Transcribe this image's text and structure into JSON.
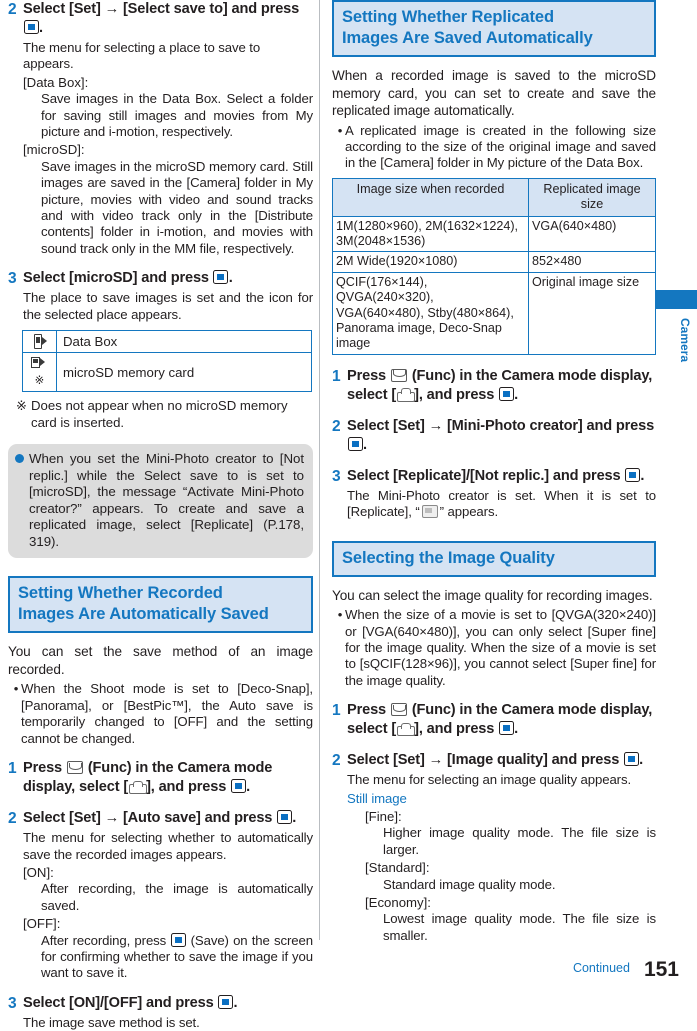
{
  "page": {
    "number": "151",
    "continued_label": "Continued",
    "side_tab_label": "Camera"
  },
  "left_column": {
    "step2": {
      "num": "2",
      "title_a": "Select [Set] ",
      "title_arrow": "→",
      "title_b": " [Select save to] and press",
      "title_end": ".",
      "desc": "The menu for selecting a place to save to appears.",
      "term1": "[Data Box]:",
      "def1": "Save images in the Data Box. Select a folder for saving still images and movies from My picture and i-motion, respectively.",
      "term2": "[microSD]:",
      "def2": "Save images in the microSD memory card. Still images are saved in the [Camera] folder in My picture, movies with video and sound tracks and with video track only in the [Distribute contents] folder in i-motion, and movies with sound track only in the MM file, respectively."
    },
    "step3": {
      "num": "3",
      "title_a": "Select [microSD] and press",
      "title_end": ".",
      "desc": "The place to save images is set and the icon for the selected place appears."
    },
    "icon_table": {
      "rows": [
        {
          "icon": "data-box-icon",
          "label": "Data Box"
        },
        {
          "icon": "microsd-card-icon",
          "label": "microSD memory card"
        }
      ]
    },
    "footnote": {
      "mark": "※",
      "text": "Does not appear when no microSD memory card is inserted."
    },
    "note": {
      "text": "When you set the Mini-Photo creator to [Not replic.] while the Select save to is set to [microSD], the message “Activate Mini-Photo creator?” appears. To create and save a replicated image, select [Replicate] (P.178, 319)."
    },
    "section": {
      "heading_line1": "Setting Whether Recorded",
      "heading_line2": "Images Are Automatically Saved",
      "intro": "You can set the save method of an image recorded.",
      "bullet1": "When the Shoot mode is set to [Deco-Snap], [Panorama], or [BestPic™], the Auto save is temporarily changed to [OFF] and the setting cannot be changed.",
      "step1": {
        "num": "1",
        "title_a": "Press",
        "title_b": "(Func) in the Camera mode display, select [",
        "title_c": "], and press",
        "title_end": "."
      },
      "step2": {
        "num": "2",
        "title_a": "Select [Set] ",
        "title_arrow": "→",
        "title_b": " [Auto save] and press",
        "title_end": ".",
        "desc": "The menu for selecting whether to automatically save the recorded images appears.",
        "term_on": "[ON]:",
        "def_on": "After recording, the image is automatically saved.",
        "term_off": "[OFF]:",
        "def_off_a": "After recording, press",
        "def_off_b": "(Save) on the screen for confirming whether to save the image if you want to save it."
      },
      "step3": {
        "num": "3",
        "title_a": "Select [ON]/[OFF] and press",
        "title_end": ".",
        "desc": "The image save method is set."
      }
    }
  },
  "right_column": {
    "section_replicated": {
      "heading_line1": "Setting Whether Replicated",
      "heading_line2": "Images Are Saved Automatically",
      "intro": "When a recorded image is saved to the microSD memory card, you can set to create and save the replicated image automatically.",
      "bullet1": "A replicated image is created in the following size according to the size of the original image and saved in the [Camera] folder in My picture of the Data Box.",
      "table": {
        "headers": [
          "Image size when recorded",
          "Replicated image size"
        ],
        "rows": [
          {
            "recorded": "1M(1280×960), 2M(1632×1224), 3M(2048×1536)",
            "replicated": "VGA(640×480)"
          },
          {
            "recorded": "2M Wide(1920×1080)",
            "replicated": "852×480"
          },
          {
            "recorded": "QCIF(176×144), QVGA(240×320), VGA(640×480), Stby(480×864), Panorama image, Deco-Snap image",
            "replicated": "Original image size"
          }
        ]
      },
      "step1": {
        "num": "1",
        "title_a": "Press",
        "title_b": "(Func) in the Camera mode display, select [",
        "title_c": "], and press",
        "title_end": "."
      },
      "step2": {
        "num": "2",
        "title_a": "Select [Set] ",
        "title_arrow": "→",
        "title_b": " [Mini-Photo creator] and press",
        "title_end": "."
      },
      "step3": {
        "num": "3",
        "title_a": "Select [Replicate]/[Not replic.] and press",
        "title_end": ".",
        "desc_a": "The Mini-Photo creator is set. When it is set to [Replicate], “",
        "desc_b": "” appears."
      }
    },
    "section_quality": {
      "heading_line1": "Selecting the Image Quality",
      "intro": "You can select the image quality for recording images.",
      "bullet1": "When the size of a movie is set to [QVGA(320×240)] or [VGA(640×480)], you can only select [Super fine] for the image quality. When the size of a movie is set to [sQCIF(128×96)], you cannot select [Super fine] for the image quality.",
      "step1": {
        "num": "1",
        "title_a": "Press",
        "title_b": "(Func) in the Camera mode display, select [",
        "title_c": "], and press",
        "title_end": "."
      },
      "step2": {
        "num": "2",
        "title_a": "Select [Set] ",
        "title_arrow": "→",
        "title_b": " [Image quality] and press",
        "title_end": ".",
        "desc": "The menu for selecting an image quality appears.",
        "subhead": "Still image",
        "term_fine": "[Fine]:",
        "def_fine": "Higher image quality mode. The file size is larger.",
        "term_standard": "[Standard]:",
        "def_standard": "Standard image quality mode.",
        "term_economy": "[Economy]:",
        "def_economy": "Lowest image quality mode. The file size is smaller."
      }
    }
  },
  "colors": {
    "accent_blue": "#1477c0",
    "heading_bg": "#d5e3f3",
    "note_bg": "#dcdcdc",
    "text": "#231f20"
  }
}
